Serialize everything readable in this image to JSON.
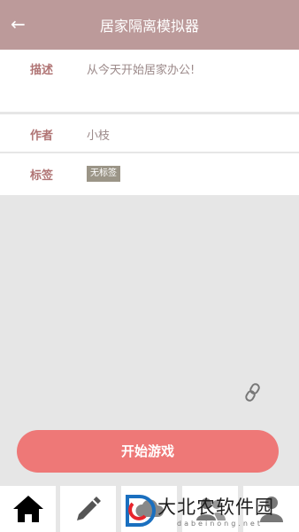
{
  "header": {
    "back_icon": "arrow-left-icon",
    "title": "居家隔离模拟器"
  },
  "details": {
    "description_label": "描述",
    "description_value": "从今天开始居家办公!",
    "author_label": "作者",
    "author_value": "小枝",
    "tags_label": "标签",
    "tag_value": "无标签"
  },
  "link_icon": "link-icon",
  "start_button": {
    "label": "开始游戏"
  },
  "bottom_nav": {
    "icons": [
      "home-icon",
      "pencil-icon",
      "cloud-icon",
      "people-icon",
      "person-icon"
    ]
  },
  "watermark": {
    "text": "大北农软件园",
    "sub": "dabeinong.net"
  },
  "colors": {
    "header": "#bc9a9a",
    "button": "#ee7877",
    "label": "#b07474",
    "tag_bg": "#9b9587",
    "background": "#e6e6e6"
  }
}
